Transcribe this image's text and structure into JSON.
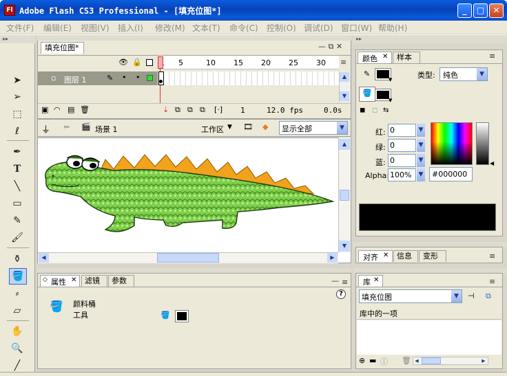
{
  "window": {
    "title": "Adobe Flash CS3 Professional - [填充位图*]",
    "app_icon": "Fl",
    "min": "_",
    "max": "□",
    "close": "✕"
  },
  "menu": [
    "文件(F)",
    "编辑(E)",
    "视图(V)",
    "插入(I)",
    "修改(M)",
    "文本(T)",
    "命令(C)",
    "控制(O)",
    "调试(D)",
    "窗口(W)",
    "帮助(H)"
  ],
  "timeline": {
    "doc_tab": "填充位图*",
    "frame_ticks": [
      "1",
      "5",
      "10",
      "15",
      "20",
      "25",
      "30"
    ],
    "layer_name": "图层 1",
    "status": {
      "frame": "1",
      "fps": "12.0 fps",
      "time": "0.0s"
    }
  },
  "edit_bar": {
    "scene": "场景 1",
    "workspace": "工作区",
    "zoom": "显示全部"
  },
  "properties": {
    "tabs": [
      "属性",
      "滤镜",
      "参数"
    ],
    "tool_name": "颜料桶",
    "tool_label": "工具",
    "help": "?"
  },
  "color_panel": {
    "tabs": [
      "颜色",
      "样本"
    ],
    "type_label": "类型:",
    "type_value": "纯色",
    "red_label": "红:",
    "red": "0",
    "green_label": "绿:",
    "green": "0",
    "blue_label": "蓝:",
    "blue": "0",
    "alpha_label": "Alpha:",
    "alpha": "100%",
    "hex": "#000000",
    "swatch_color": "#000000"
  },
  "align_panel": {
    "tabs": [
      "对齐",
      "信息",
      "变形"
    ]
  },
  "library": {
    "tab": "库",
    "document": "填充位图",
    "item": "库中的一项"
  },
  "accent": {
    "title_blue": "#0a58d8",
    "playhead_red": "#e03030",
    "crocodile_green": "#7ccb4a",
    "spike_orange": "#f0a020"
  }
}
